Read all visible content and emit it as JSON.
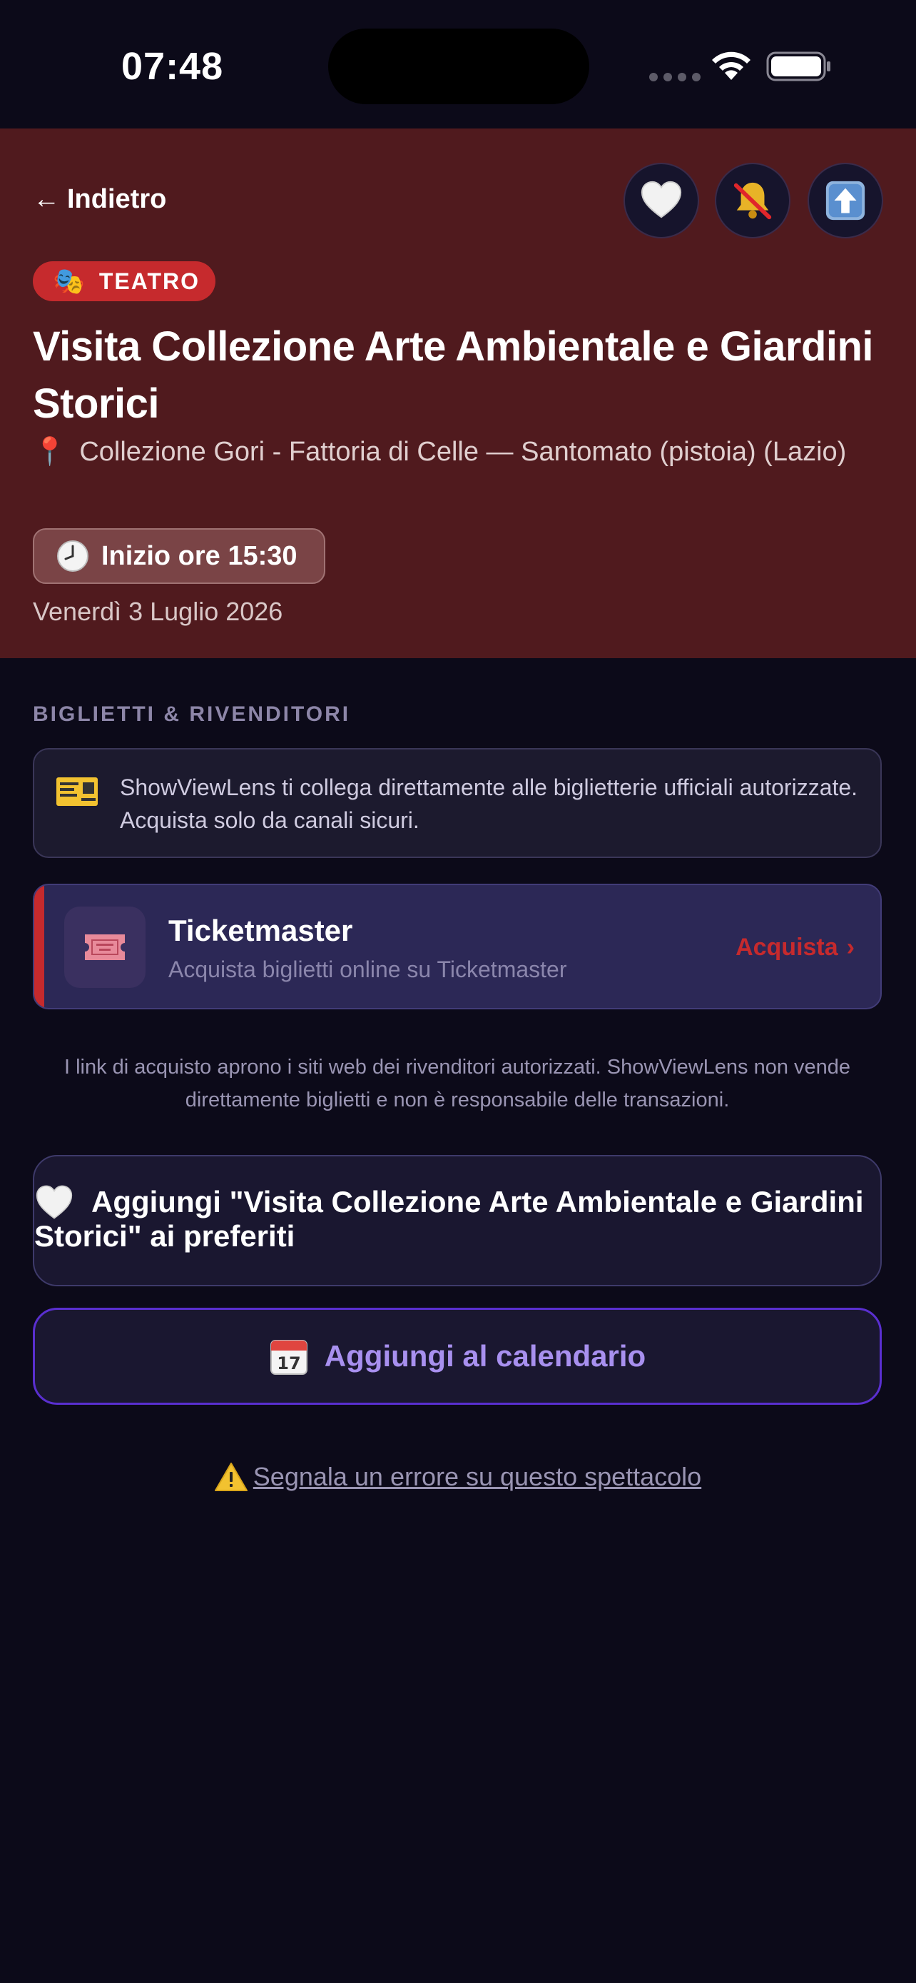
{
  "status_bar": {
    "time": "07:48"
  },
  "header": {
    "back_label": "Indietro",
    "back_arrow": "←",
    "category": "TEATRO",
    "category_icon": "🎭",
    "title": "Visita Collezione Arte Ambientale e Giardini Storici",
    "venue": "Collezione Gori - Fattoria di Celle — Santomato (pistoia) (Lazio)",
    "venue_icon": "📍",
    "start_time": "Inizio ore 15:30",
    "date": "Venerdì 3 Luglio 2026",
    "background_color": "#501a1e"
  },
  "tickets": {
    "section_title": "BIGLIETTI & RIVENDITORI",
    "info_text": "ShowViewLens ti collega direttamente alle biglietterie ufficiali autorizzate. Acquista solo da canali sicuri.",
    "vendors": [
      {
        "name": "Ticketmaster",
        "description": "Acquista biglietti online su Ticketmaster",
        "action": "Acquista",
        "action_icon": "›",
        "accent_color": "#c62a2d"
      }
    ],
    "disclaimer": "I link di acquisto aprono i siti web dei rivenditori autorizzati. ShowViewLens non vende direttamente biglietti e non è responsabile delle transazioni."
  },
  "actions": {
    "favorite_label": "Aggiungi \"Visita Collezione Arte Ambientale e Giardini Storici\" ai preferiti",
    "calendar_label": "Aggiungi al calendario",
    "report_label": "Segnala un errore su questo spettacolo"
  },
  "colors": {
    "background": "#0c0a19",
    "accent_red": "#c62a2d",
    "accent_purple": "#a890ef"
  }
}
